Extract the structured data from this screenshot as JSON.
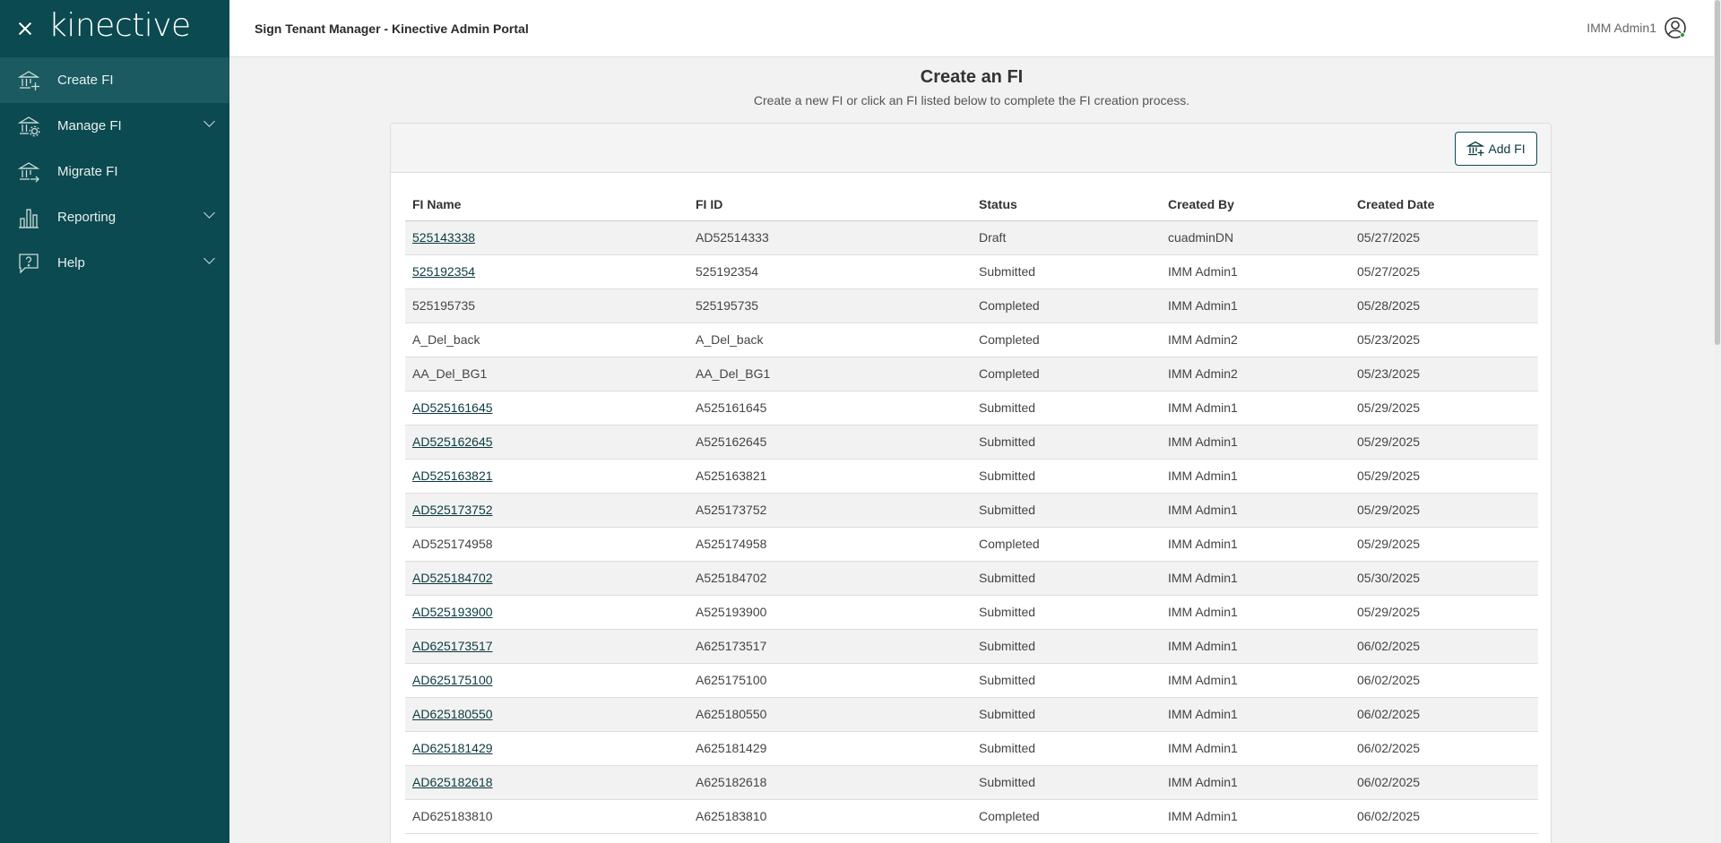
{
  "brand": {
    "logo_text": "kinective"
  },
  "topbar": {
    "title": "Sign Tenant Manager - Kinective Admin Portal",
    "user_name": "IMM Admin1"
  },
  "sidebar": {
    "items": [
      {
        "label": "Create FI",
        "icon": "bank-plus-icon",
        "active": true,
        "expandable": false
      },
      {
        "label": "Manage FI",
        "icon": "bank-gear-icon",
        "active": false,
        "expandable": true
      },
      {
        "label": "Migrate FI",
        "icon": "bank-arrow-icon",
        "active": false,
        "expandable": false
      },
      {
        "label": "Reporting",
        "icon": "bar-chart-icon",
        "active": false,
        "expandable": true
      },
      {
        "label": "Help",
        "icon": "help-chat-icon",
        "active": false,
        "expandable": true
      }
    ]
  },
  "main": {
    "title": "Create an FI",
    "subtitle": "Create a new FI or click an FI listed below to complete the FI creation process.",
    "add_button_label": "Add FI"
  },
  "table": {
    "headers": [
      "FI Name",
      "FI ID",
      "Status",
      "Created By",
      "Created Date"
    ],
    "rows": [
      {
        "name": "525143338",
        "id": "AD52514333",
        "status": "Draft",
        "created_by": "cuadminDN",
        "date": "05/27/2025",
        "link": true
      },
      {
        "name": "525192354",
        "id": "525192354",
        "status": "Submitted",
        "created_by": "IMM Admin1",
        "date": "05/27/2025",
        "link": true
      },
      {
        "name": "525195735",
        "id": "525195735",
        "status": "Completed",
        "created_by": "IMM Admin1",
        "date": "05/28/2025",
        "link": false
      },
      {
        "name": "A_Del_back",
        "id": "A_Del_back",
        "status": "Completed",
        "created_by": "IMM Admin2",
        "date": "05/23/2025",
        "link": false
      },
      {
        "name": "AA_Del_BG1",
        "id": "AA_Del_BG1",
        "status": "Completed",
        "created_by": "IMM Admin2",
        "date": "05/23/2025",
        "link": false
      },
      {
        "name": "AD525161645",
        "id": "A525161645",
        "status": "Submitted",
        "created_by": "IMM Admin1",
        "date": "05/29/2025",
        "link": true
      },
      {
        "name": "AD525162645",
        "id": "A525162645",
        "status": "Submitted",
        "created_by": "IMM Admin1",
        "date": "05/29/2025",
        "link": true
      },
      {
        "name": "AD525163821",
        "id": "A525163821",
        "status": "Submitted",
        "created_by": "IMM Admin1",
        "date": "05/29/2025",
        "link": true
      },
      {
        "name": "AD525173752",
        "id": "A525173752",
        "status": "Submitted",
        "created_by": "IMM Admin1",
        "date": "05/29/2025",
        "link": true
      },
      {
        "name": "AD525174958",
        "id": "A525174958",
        "status": "Completed",
        "created_by": "IMM Admin1",
        "date": "05/29/2025",
        "link": false
      },
      {
        "name": "AD525184702",
        "id": "A525184702",
        "status": "Submitted",
        "created_by": "IMM Admin1",
        "date": "05/30/2025",
        "link": true
      },
      {
        "name": "AD525193900",
        "id": "A525193900",
        "status": "Submitted",
        "created_by": "IMM Admin1",
        "date": "05/29/2025",
        "link": true
      },
      {
        "name": "AD625173517",
        "id": "A625173517",
        "status": "Submitted",
        "created_by": "IMM Admin1",
        "date": "06/02/2025",
        "link": true
      },
      {
        "name": "AD625175100",
        "id": "A625175100",
        "status": "Submitted",
        "created_by": "IMM Admin1",
        "date": "06/02/2025",
        "link": true
      },
      {
        "name": "AD625180550",
        "id": "A625180550",
        "status": "Submitted",
        "created_by": "IMM Admin1",
        "date": "06/02/2025",
        "link": true
      },
      {
        "name": "AD625181429",
        "id": "A625181429",
        "status": "Submitted",
        "created_by": "IMM Admin1",
        "date": "06/02/2025",
        "link": true
      },
      {
        "name": "AD625182618",
        "id": "A625182618",
        "status": "Submitted",
        "created_by": "IMM Admin1",
        "date": "06/02/2025",
        "link": true
      },
      {
        "name": "AD625183810",
        "id": "A625183810",
        "status": "Completed",
        "created_by": "IMM Admin1",
        "date": "06/02/2025",
        "link": false
      }
    ]
  },
  "colors": {
    "sidebar_bg": "#0b4a50",
    "sidebar_active": "#1a5a60",
    "link": "#0b3a40"
  }
}
